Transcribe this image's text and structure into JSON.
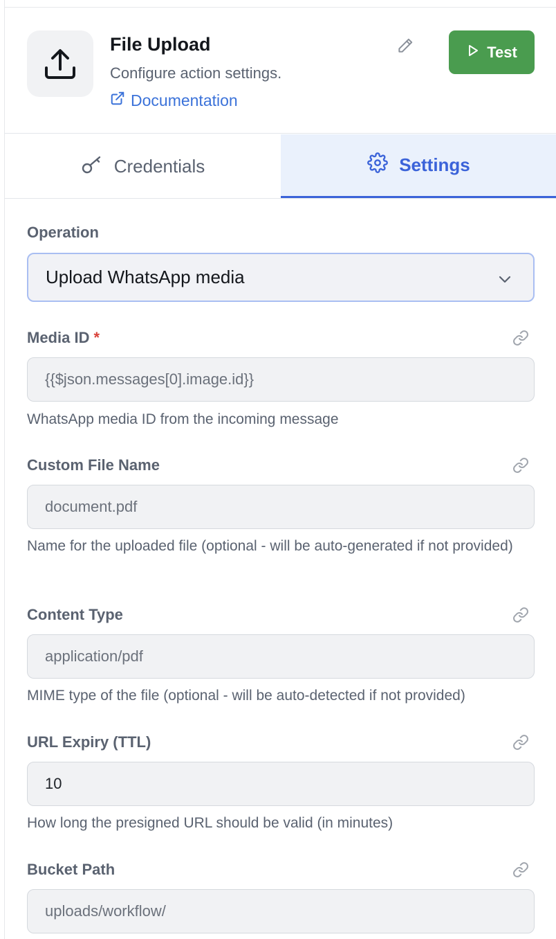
{
  "header": {
    "title": "File Upload",
    "subtitle": "Configure action settings.",
    "doc_link": "Documentation",
    "test_label": "Test",
    "icon": "upload-icon"
  },
  "tabs": [
    {
      "label": "Credentials",
      "icon": "key-icon",
      "active": false
    },
    {
      "label": "Settings",
      "icon": "gear-icon",
      "active": true
    }
  ],
  "form": {
    "operation": {
      "label": "Operation",
      "value": "Upload WhatsApp media"
    },
    "media_id": {
      "label": "Media ID",
      "required_mark": "*",
      "value": "{{$json.messages[0].image.id}}",
      "help": "WhatsApp media ID from the incoming message"
    },
    "custom_file_name": {
      "label": "Custom File Name",
      "placeholder": "document.pdf",
      "help": "Name for the uploaded file (optional - will be auto-generated if not provided)"
    },
    "content_type": {
      "label": "Content Type",
      "placeholder": "application/pdf",
      "help": "MIME type of the file (optional - will be auto-detected if not provided)"
    },
    "url_expiry": {
      "label": "URL Expiry (TTL)",
      "value": "10",
      "help": "How long the presigned URL should be valid (in minutes)"
    },
    "bucket_path": {
      "label": "Bucket Path",
      "placeholder": "uploads/workflow/"
    }
  },
  "colors": {
    "accent": "#3b63d9",
    "test_button": "#4a9c4f",
    "required": "#d9433b"
  }
}
